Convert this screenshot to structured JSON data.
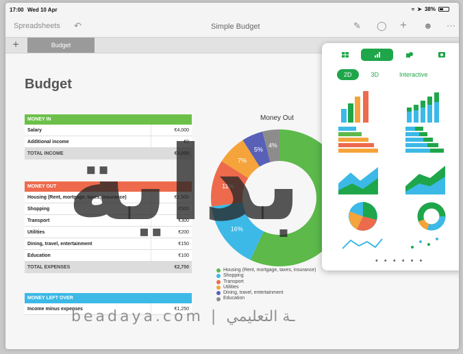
{
  "status": {
    "time": "17:00",
    "date": "Wed 10 Apr",
    "battery": "38%"
  },
  "toolbar": {
    "back_label": "Spreadsheets",
    "title": "Simple Budget"
  },
  "tabs": {
    "sheet_tab": "Budget"
  },
  "sheet": {
    "title": "Budget"
  },
  "money_in": {
    "header": "MONEY IN",
    "header_color": "#6cc04a",
    "rows": [
      {
        "label": "Salary",
        "value": "€4,000"
      },
      {
        "label": "Additional income",
        "value": "€0"
      }
    ],
    "total": {
      "label": "TOTAL INCOME",
      "value": "€4,000"
    }
  },
  "money_out": {
    "header": "MONEY OUT",
    "header_color": "#ee6a4c",
    "rows": [
      {
        "label": "Housing (Rent, mortgage, taxes, insurance)",
        "value": "€1,500"
      },
      {
        "label": "Shopping",
        "value": "€500"
      },
      {
        "label": "Transport",
        "value": "€300"
      },
      {
        "label": "Utilities",
        "value": "€200"
      },
      {
        "label": "Dining, travel, entertainment",
        "value": "€150"
      },
      {
        "label": "Education",
        "value": "€100"
      }
    ],
    "total": {
      "label": "TOTAL EXPENSES",
      "value": "€2,750"
    }
  },
  "money_left": {
    "header": "MONEY LEFT OVER",
    "header_color": "#3cb9e6",
    "rows": [
      {
        "label": "Income minus expenses",
        "value": "€1,250"
      }
    ]
  },
  "chart_data": {
    "type": "pie",
    "title": "Money Out",
    "categories": [
      "Housing (Rent, mortgage, taxes, insurance)",
      "Shopping",
      "Transport",
      "Utilities",
      "Dining, travel, entertainment",
      "Education"
    ],
    "values": [
      57,
      16,
      11,
      7,
      5,
      4
    ],
    "slice_labels": [
      "",
      "16%",
      "11%",
      "7%",
      "5%",
      "4%"
    ],
    "colors": [
      "#5cb94a",
      "#3cb9e6",
      "#ee6a4c",
      "#f5a43b",
      "#5860b8",
      "#8c8c8c"
    ],
    "legend_placement": "bottom"
  },
  "popover": {
    "modes": [
      "2D",
      "3D",
      "Interactive"
    ],
    "page_dots": "• • • • • •"
  },
  "watermark": {
    "text_big": "بداية",
    "text_line": "beadaya.com | ـة التعليمي"
  }
}
